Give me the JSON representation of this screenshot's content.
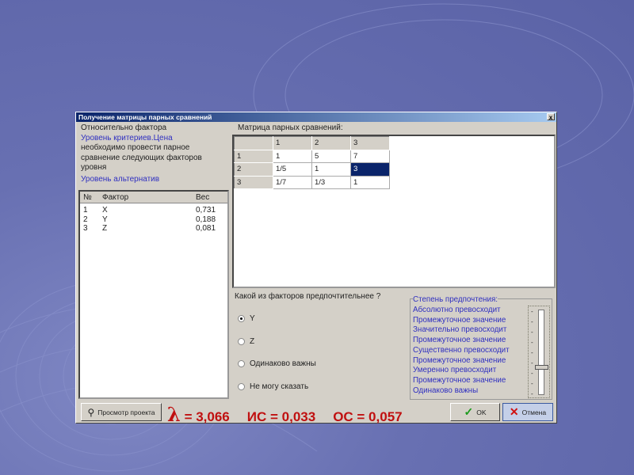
{
  "dialog": {
    "title": "Получение матрицы парных сравнений",
    "close": "x"
  },
  "left": {
    "line1": "Относительно фактора",
    "criteria": "Уровень критериев.Цена",
    "desc": "необходимо провести парное сравнение следующих факторов уровня",
    "alt": "Уровень альтернатив",
    "headers": [
      "№",
      "Фактор",
      "Вес"
    ],
    "rows": [
      [
        "1",
        "X",
        "0,731"
      ],
      [
        "2",
        "Y",
        "0,188"
      ],
      [
        "3",
        "Z",
        "0,081"
      ]
    ]
  },
  "matrix": {
    "label": "Матрица парных сравнений:",
    "cols": [
      "1",
      "2",
      "3"
    ],
    "rows": [
      {
        "h": "1",
        "v": [
          "1",
          "5",
          "7"
        ]
      },
      {
        "h": "2",
        "v": [
          "1/5",
          "1",
          "3"
        ]
      },
      {
        "h": "3",
        "v": [
          "1/7",
          "1/3",
          "1"
        ]
      }
    ]
  },
  "question": "Какой из факторов предпочтительнее ?",
  "options": [
    {
      "label": "Y",
      "checked": true
    },
    {
      "label": "Z",
      "checked": false
    },
    {
      "label": "Одинаково важны",
      "checked": false
    },
    {
      "label": "Не могу сказать",
      "checked": false
    }
  ],
  "preference": {
    "title": "Степень предпочтения:",
    "levels": [
      "Абсолютно превосходит",
      "Промежуточное значение",
      "Значительно превосходит",
      "Промежуточное значение",
      "Существенно превосходит",
      "Промежуточное значение",
      "Умеренно превосходит",
      "Промежуточное значение",
      "Одинаково важны"
    ],
    "selected": "Умеренно превосходит"
  },
  "buttons": {
    "preview": "Просмотр проекта",
    "ok": "OK",
    "cancel": "Отмена"
  },
  "metrics": {
    "lambda": "λ",
    "lambda_val": "= 3,066",
    "ic": "ИС = 0,033",
    "oc": "ОС = 0,057"
  }
}
